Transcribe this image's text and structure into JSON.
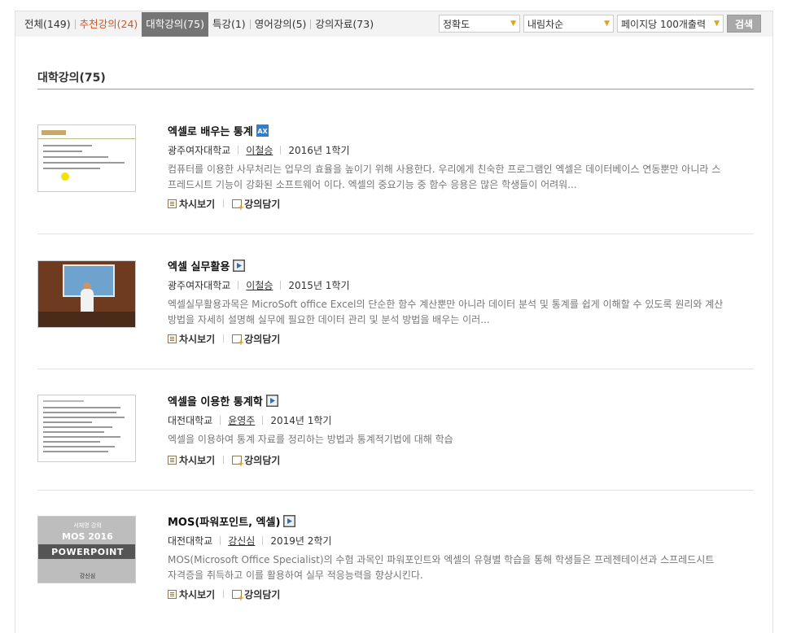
{
  "tabs": [
    {
      "label": "전체(149)"
    },
    {
      "label": "추천강의(24)"
    },
    {
      "label": "대학강의(75)"
    },
    {
      "label": "특강(1)"
    },
    {
      "label": "영어강의(5)"
    },
    {
      "label": "강의자료(73)"
    }
  ],
  "controls": {
    "sort_field": "정확도",
    "sort_order": "내림차순",
    "page_size": "페이지당 100개출력",
    "search_label": "검색"
  },
  "section_title": "대학강의(75)",
  "colors": {
    "accent_orange": "#d9541d",
    "active_tab": "#757575",
    "caret": "#e6a014"
  },
  "lectures": [
    {
      "title": "엑셀로 배우는 통계",
      "badge_icon": "ax-icon",
      "university": "광주여자대학교",
      "professor": "이철승",
      "term": "2016년 1학기",
      "description": "컴퓨터를 이용한 사무처리는 업무의 효율을 높이기 위해 사용한다. 우리에게 친숙한 프로그램인 엑셀은 데이터베이스 연동뿐만 아니라 스프레드시트 기능이 강화된 소프트웨어 이다. 엑셀의 중요기능 중 함수 응용은 많은 학생들이 어려워...",
      "actions": [
        "차시보기",
        "강의담기"
      ]
    },
    {
      "title": "엑셀 실무활용",
      "badge_icon": "video-icon",
      "university": "광주여자대학교",
      "professor": "이철승",
      "term": "2015년 1학기",
      "description": "엑셀실무활용과목은 MicroSoft office Excel의 단순한 함수 계산뿐만 아니라 데이터 분석 및 통계를 쉽게 이해할 수 있도록 원리와 계산 방법을 자세히 설명해 실무에 필요한 데이터 관리 및 분석 방법을 배우는 이러...",
      "actions": [
        "차시보기",
        "강의담기"
      ]
    },
    {
      "title": "엑셀을 이용한 통계학",
      "badge_icon": "video-icon",
      "university": "대전대학교",
      "professor": "윤영주",
      "term": "2014년 1학기",
      "description": "엑셀을 이용하여 통계 자료를 정리하는 방법과 통계적기법에 대해 학습",
      "actions": [
        "차시보기",
        "강의담기"
      ]
    },
    {
      "title": "MOS(파워포인트, 엑셀)",
      "badge_icon": "video-icon",
      "university": "대전대학교",
      "professor": "강신심",
      "term": "2019년 2학기",
      "description": "MOS(Microsoft Office Specialist)의 수험 과목인 파워포인트와 엑셀의 유형별 학습을 통해 학생들은 프레젠테이션과 스프레드시트 자격증을 취득하고 이를 활용하여 실무 적응능력을 향상시킨다.",
      "actions": [
        "차시보기",
        "강의담기"
      ],
      "thumb_text": [
        "서체명 강의",
        "MOS 2016",
        "POWERPOINT",
        "강신심"
      ]
    }
  ]
}
